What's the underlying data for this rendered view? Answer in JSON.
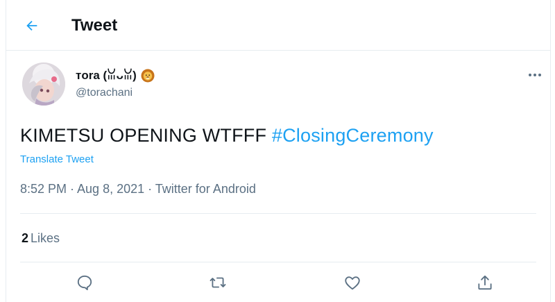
{
  "header": {
    "title": "Tweet",
    "back_icon": "arrow-left-icon"
  },
  "author": {
    "name": "тora (ꈍᴗꈍ)",
    "handle": "@torachani",
    "emoji_icon": "lion-face-icon"
  },
  "tweet": {
    "text_plain": "KIMETSU OPENING WTFFF",
    "hashtag": "#ClosingCeremony",
    "translate_label": "Translate Tweet",
    "meta": "8:52 PM · Aug 8, 2021 · Twitter for Android"
  },
  "stats": {
    "likes_count": "2",
    "likes_label": "Likes"
  },
  "actions": [
    "reply-icon",
    "retweet-icon",
    "like-icon",
    "share-icon"
  ],
  "colors": {
    "accent": "#1da1f2",
    "secondary_text": "#5b7083",
    "divider": "#e6ecf0"
  }
}
